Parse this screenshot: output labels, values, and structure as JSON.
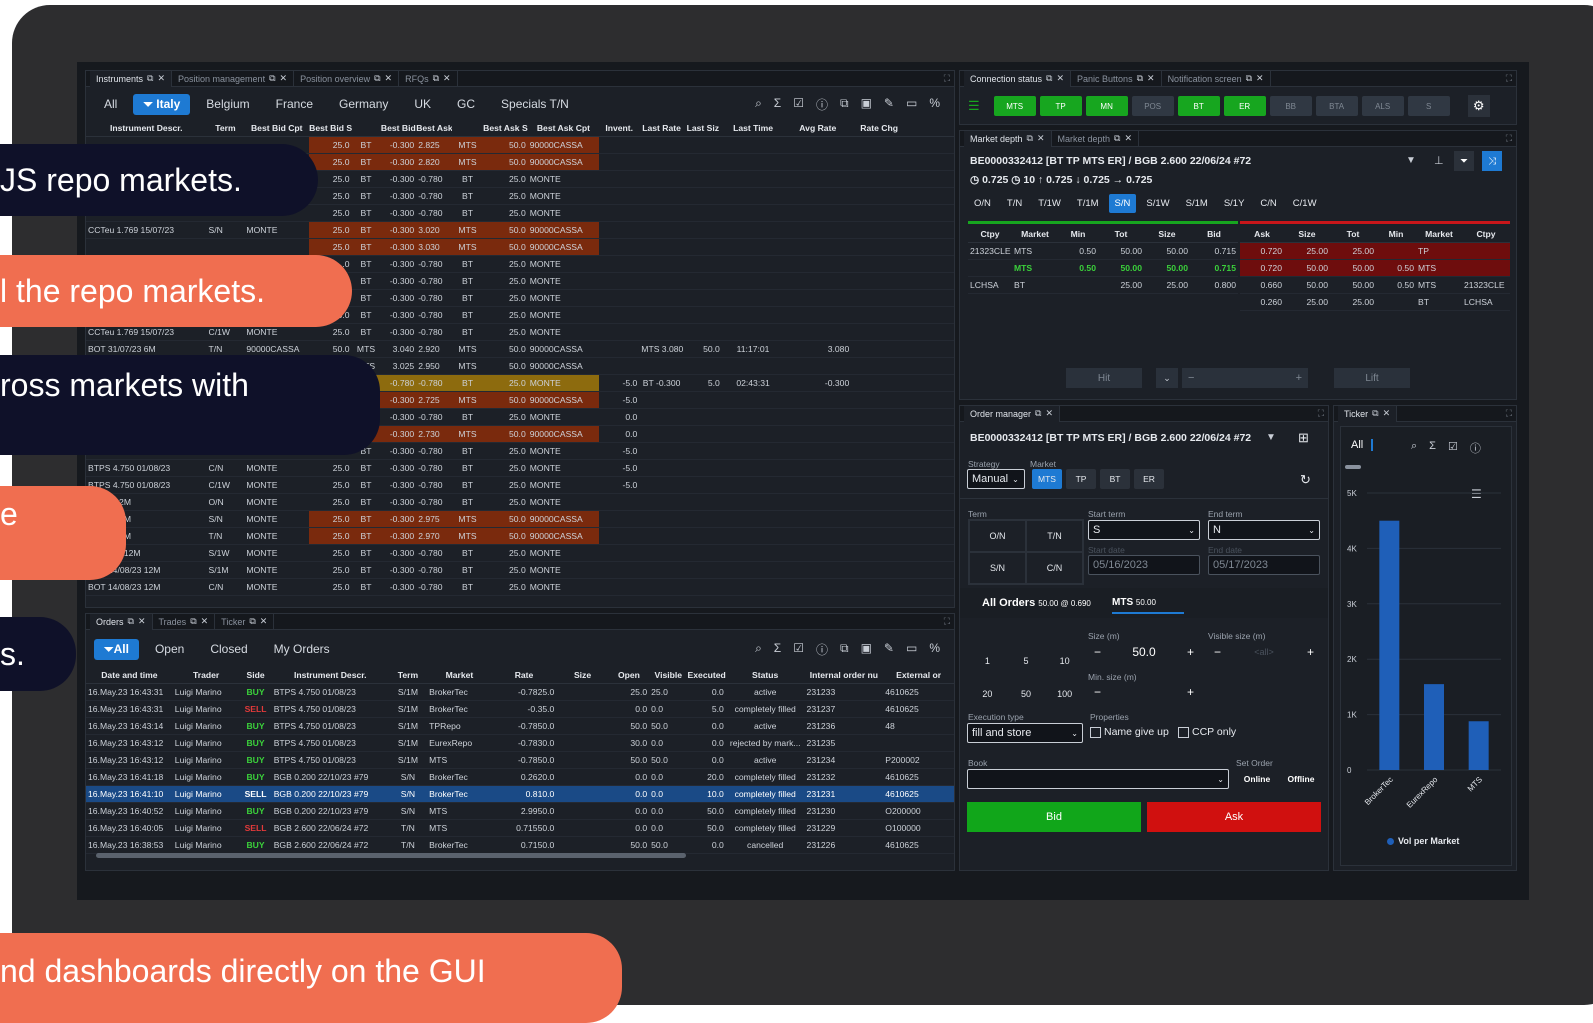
{
  "callouts": [
    {
      "text": "JS repo markets."
    },
    {
      "text": "l the repo markets."
    },
    {
      "text": "ross markets with"
    },
    {
      "text": "e"
    },
    {
      "text": "s."
    },
    {
      "text": "nd dashboards directly on the GUI"
    }
  ],
  "instruments_panel": {
    "tabs": [
      "Instruments",
      "Position management",
      "Position overview",
      "RFQs"
    ],
    "filters": [
      "All",
      "Italy",
      "Belgium",
      "France",
      "Germany",
      "UK",
      "GC",
      "Specials T/N"
    ],
    "columns": [
      "Instrument Descr.",
      "Term",
      "Best Bid Cpt",
      "Best Bid Siz",
      "Best Bid",
      "Best Ask",
      "Best Ask Siz",
      "Best Ask Cpt",
      "Invent.",
      "Last Rate",
      "Last Siz",
      "Last Time",
      "Avg Rate",
      "Rate Chg"
    ],
    "rows": [
      {
        "d": "",
        "t": "",
        "bbc": "",
        "bbs": "25.0",
        "m1": "BT",
        "bb": "-0.300",
        "ba": "2.825",
        "m2": "MTS",
        "bas": "50.0",
        "bac": "90000CASSA",
        "inv": "",
        "lr": "",
        "ls": "",
        "lt": "",
        "ar": "",
        "hl": "o"
      },
      {
        "d": "",
        "t": "",
        "bbc": "",
        "bbs": "25.0",
        "m1": "BT",
        "bb": "-0.300",
        "ba": "2.820",
        "m2": "MTS",
        "bas": "50.0",
        "bac": "90000CASSA",
        "inv": "",
        "lr": "",
        "ls": "",
        "lt": "",
        "ar": "",
        "hl": "o"
      },
      {
        "d": "",
        "t": "",
        "bbc": "",
        "bbs": "25.0",
        "m1": "BT",
        "bb": "-0.300",
        "ba": "-0.780",
        "m2": "BT",
        "bas": "25.0",
        "bac": "MONTE",
        "inv": "",
        "lr": "",
        "ls": "",
        "lt": "",
        "ar": "",
        "hl": ""
      },
      {
        "d": "",
        "t": "",
        "bbc": "",
        "bbs": "25.0",
        "m1": "BT",
        "bb": "-0.300",
        "ba": "-0.780",
        "m2": "BT",
        "bas": "25.0",
        "bac": "MONTE",
        "inv": "",
        "lr": "",
        "ls": "",
        "lt": "",
        "ar": "",
        "hl": ""
      },
      {
        "d": "BOT 14/07/23 12M",
        "t": "C/N",
        "bbc": "MONTE",
        "bbs": "25.0",
        "m1": "BT",
        "bb": "-0.300",
        "ba": "-0.780",
        "m2": "BT",
        "bas": "25.0",
        "bac": "MONTE",
        "inv": "",
        "lr": "",
        "ls": "",
        "lt": "",
        "ar": "",
        "hl": ""
      },
      {
        "d": "CCTeu 1.769 15/07/23",
        "t": "S/N",
        "bbc": "MONTE",
        "bbs": "25.0",
        "m1": "BT",
        "bb": "-0.300",
        "ba": "3.020",
        "m2": "MTS",
        "bas": "50.0",
        "bac": "90000CASSA",
        "inv": "",
        "lr": "",
        "ls": "",
        "lt": "",
        "ar": "",
        "hl": "o"
      },
      {
        "d": "",
        "t": "",
        "bbc": "",
        "bbs": "25.0",
        "m1": "BT",
        "bb": "-0.300",
        "ba": "3.030",
        "m2": "MTS",
        "bas": "50.0",
        "bac": "90000CASSA",
        "inv": "",
        "lr": "",
        "ls": "",
        "lt": "",
        "ar": "",
        "hl": "o"
      },
      {
        "d": "",
        "t": "",
        "bbc": "",
        "bbs": ".0",
        "m1": "BT",
        "bb": "-0.300",
        "ba": "-0.780",
        "m2": "BT",
        "bas": "25.0",
        "bac": "MONTE",
        "inv": "",
        "lr": "",
        "ls": "",
        "lt": "",
        "ar": "",
        "hl": ""
      },
      {
        "d": "",
        "t": "",
        "bbc": "",
        "bbs": ".0",
        "m1": "BT",
        "bb": "-0.300",
        "ba": "-0.780",
        "m2": "BT",
        "bas": "25.0",
        "bac": "MONTE",
        "inv": "",
        "lr": "",
        "ls": "",
        "lt": "",
        "ar": "",
        "hl": ""
      },
      {
        "d": "",
        "t": "",
        "bbc": "",
        "bbs": "5.0",
        "m1": "BT",
        "bb": "-0.300",
        "ba": "-0.780",
        "m2": "BT",
        "bas": "25.0",
        "bac": "MONTE",
        "inv": "",
        "lr": "",
        "ls": "",
        "lt": "",
        "ar": "",
        "hl": ""
      },
      {
        "d": "",
        "t": "",
        "bbc": "MONTE",
        "bbs": "25.0",
        "m1": "BT",
        "bb": "-0.300",
        "ba": "-0.780",
        "m2": "BT",
        "bas": "25.0",
        "bac": "MONTE",
        "inv": "",
        "lr": "",
        "ls": "",
        "lt": "",
        "ar": "",
        "hl": ""
      },
      {
        "d": "CCTeu 1.769 15/07/23",
        "t": "C/1W",
        "bbc": "MONTE",
        "bbs": "25.0",
        "m1": "BT",
        "bb": "-0.300",
        "ba": "-0.780",
        "m2": "BT",
        "bas": "25.0",
        "bac": "MONTE",
        "inv": "",
        "lr": "",
        "ls": "",
        "lt": "",
        "ar": "",
        "hl": ""
      },
      {
        "d": "BOT 31/07/23 6M",
        "t": "T/N",
        "bbc": "90000CASSA",
        "bbs": "50.0",
        "m1": "MTS",
        "bb": "3.040",
        "ba": "2.920",
        "m2": "MTS",
        "bas": "50.0",
        "bac": "90000CASSA",
        "inv": "",
        "lr": "MTS 3.080",
        "ls": "50.0",
        "lt": "11:17:01",
        "ar": "3.080",
        "hl": ""
      },
      {
        "d": "",
        "t": "",
        "bbc": "",
        "bbs": "",
        "m1": "MTS",
        "bb": "3.025",
        "ba": "2.950",
        "m2": "MTS",
        "bas": "50.0",
        "bac": "90000CASSA",
        "inv": "",
        "lr": "",
        "ls": "",
        "lt": "",
        "ar": "",
        "hl": ""
      },
      {
        "d": "",
        "t": "",
        "bbc": "",
        "bbs": "",
        "m1": "",
        "bb": "-0.780",
        "ba": "-0.780",
        "m2": "BT",
        "bas": "25.0",
        "bac": "MONTE",
        "inv": "-5.0",
        "lr": "BT -0.300",
        "ls": "5.0",
        "lt": "02:43:31",
        "ar": "-0.300",
        "hl": "y"
      },
      {
        "d": "",
        "t": "",
        "bbc": "",
        "bbs": "",
        "m1": "",
        "bb": "-0.300",
        "ba": "2.725",
        "m2": "MTS",
        "bas": "50.0",
        "bac": "90000CASSA",
        "inv": "-5.0",
        "lr": "",
        "ls": "",
        "lt": "",
        "ar": "",
        "hl": "o"
      },
      {
        "d": "",
        "t": "",
        "bbc": "",
        "bbs": "",
        "m1": "",
        "bb": "-0.300",
        "ba": "-0.780",
        "m2": "BT",
        "bas": "25.0",
        "bac": "MONTE",
        "inv": "0.0",
        "lr": "",
        "ls": "",
        "lt": "",
        "ar": "",
        "hl": ""
      },
      {
        "d": "",
        "t": "",
        "bbc": "",
        "bbs": "",
        "m1": "BT",
        "bb": "-0.300",
        "ba": "2.730",
        "m2": "MTS",
        "bas": "50.0",
        "bac": "90000CASSA",
        "inv": "0.0",
        "lr": "",
        "ls": "",
        "lt": "",
        "ar": "",
        "hl": "o"
      },
      {
        "d": "BTPS 4.750 01/08/23",
        "t": "S/1W",
        "bbc": "MONTE",
        "bbs": "25.0",
        "m1": "BT",
        "bb": "-0.300",
        "ba": "-0.780",
        "m2": "BT",
        "bas": "25.0",
        "bac": "MONTE",
        "inv": "-5.0",
        "lr": "",
        "ls": "",
        "lt": "",
        "ar": "",
        "hl": ""
      },
      {
        "d": "BTPS 4.750 01/08/23",
        "t": "C/N",
        "bbc": "MONTE",
        "bbs": "25.0",
        "m1": "BT",
        "bb": "-0.300",
        "ba": "-0.780",
        "m2": "BT",
        "bas": "25.0",
        "bac": "MONTE",
        "inv": "-5.0",
        "lr": "",
        "ls": "",
        "lt": "",
        "ar": "",
        "hl": ""
      },
      {
        "d": "BTPS 4.750 01/08/23",
        "t": "C/1W",
        "bbc": "MONTE",
        "bbs": "25.0",
        "m1": "BT",
        "bb": "-0.300",
        "ba": "-0.780",
        "m2": "BT",
        "bas": "25.0",
        "bac": "MONTE",
        "inv": "-5.0",
        "lr": "",
        "ls": "",
        "lt": "",
        "ar": "",
        "hl": ""
      },
      {
        "d": "/08/23 12M",
        "t": "O/N",
        "bbc": "MONTE",
        "bbs": "25.0",
        "m1": "BT",
        "bb": "-0.300",
        "ba": "-0.780",
        "m2": "BT",
        "bas": "25.0",
        "bac": "MONTE",
        "inv": "",
        "lr": "",
        "ls": "",
        "lt": "",
        "ar": "",
        "hl": ""
      },
      {
        "d": "/08/23 12M",
        "t": "S/N",
        "bbc": "MONTE",
        "bbs": "25.0",
        "m1": "BT",
        "bb": "-0.300",
        "ba": "2.975",
        "m2": "MTS",
        "bas": "50.0",
        "bac": "90000CASSA",
        "inv": "",
        "lr": "",
        "ls": "",
        "lt": "",
        "ar": "",
        "hl": "o"
      },
      {
        "d": "/08/23 12M",
        "t": "T/N",
        "bbc": "MONTE",
        "bbs": "25.0",
        "m1": "BT",
        "bb": "-0.300",
        "ba": "2.970",
        "m2": "MTS",
        "bas": "50.0",
        "bac": "90000CASSA",
        "inv": "",
        "lr": "",
        "ls": "",
        "lt": "",
        "ar": "",
        "hl": "o"
      },
      {
        "d": "14/08/23 12M",
        "t": "S/1W",
        "bbc": "MONTE",
        "bbs": "25.0",
        "m1": "BT",
        "bb": "-0.300",
        "ba": "-0.780",
        "m2": "BT",
        "bas": "25.0",
        "bac": "MONTE",
        "inv": "",
        "lr": "",
        "ls": "",
        "lt": "",
        "ar": "",
        "hl": ""
      },
      {
        "d": "BOT 14/08/23 12M",
        "t": "S/1M",
        "bbc": "MONTE",
        "bbs": "25.0",
        "m1": "BT",
        "bb": "-0.300",
        "ba": "-0.780",
        "m2": "BT",
        "bas": "25.0",
        "bac": "MONTE",
        "inv": "",
        "lr": "",
        "ls": "",
        "lt": "",
        "ar": "",
        "hl": ""
      },
      {
        "d": "BOT 14/08/23 12M",
        "t": "C/N",
        "bbc": "MONTE",
        "bbs": "25.0",
        "m1": "BT",
        "bb": "-0.300",
        "ba": "-0.780",
        "m2": "BT",
        "bas": "25.0",
        "bac": "MONTE",
        "inv": "",
        "lr": "",
        "ls": "",
        "lt": "",
        "ar": "",
        "hl": ""
      }
    ]
  },
  "orders_panel": {
    "tabs": [
      "Orders",
      "Trades",
      "Ticker"
    ],
    "filters": [
      "All",
      "Open",
      "Closed",
      "My Orders"
    ],
    "columns": [
      "Date and time",
      "Trader",
      "Side",
      "Instrument Descr.",
      "Term",
      "Market",
      "Rate",
      "Size",
      "Open",
      "Visible",
      "Executed",
      "Status",
      "Internal order nu",
      "External or"
    ],
    "rows": [
      {
        "dt": "16.May.23 16:43:31",
        "tr": "Luigi Marino",
        "side": "BUY",
        "ins": "BTPS 4.750 01/08/23",
        "term": "S/1M",
        "mkt": "BrokerTec",
        "rate": "-0.7825.0",
        "size": "",
        "open": "25.0",
        "vis": "25.0",
        "exe": "0.0",
        "st": "active",
        "ino": "231233",
        "ext": "4610625"
      },
      {
        "dt": "16.May.23 16:43:31",
        "tr": "Luigi Marino",
        "side": "SELL",
        "ins": "BTPS 4.750 01/08/23",
        "term": "S/1M",
        "mkt": "BrokerTec",
        "rate": "-0.35.0",
        "size": "",
        "open": "0.0",
        "vis": "0.0",
        "exe": "5.0",
        "st": "completely filled",
        "ino": "231237",
        "ext": "4610625"
      },
      {
        "dt": "16.May.23 16:43:14",
        "tr": "Luigi Marino",
        "side": "BUY",
        "ins": "BTPS 4.750 01/08/23",
        "term": "S/1M",
        "mkt": "TPRepo",
        "rate": "-0.7850.0",
        "size": "",
        "open": "50.0",
        "vis": "50.0",
        "exe": "0.0",
        "st": "active",
        "ino": "231236",
        "ext": "48"
      },
      {
        "dt": "16.May.23 16:43:12",
        "tr": "Luigi Marino",
        "side": "BUY",
        "ins": "BTPS 4.750 01/08/23",
        "term": "S/1M",
        "mkt": "EurexRepo",
        "rate": "-0.7830.0",
        "size": "",
        "open": "30.0",
        "vis": "0.0",
        "exe": "0.0",
        "st": "rejected by mark...",
        "ino": "231235",
        "ext": ""
      },
      {
        "dt": "16.May.23 16:43:12",
        "tr": "Luigi Marino",
        "side": "BUY",
        "ins": "BTPS 4.750 01/08/23",
        "term": "S/1M",
        "mkt": "MTS",
        "rate": "-0.7850.0",
        "size": "",
        "open": "50.0",
        "vis": "50.0",
        "exe": "0.0",
        "st": "active",
        "ino": "231234",
        "ext": "P200002"
      },
      {
        "dt": "16.May.23 16:41:18",
        "tr": "Luigi Marino",
        "side": "BUY",
        "ins": "BGB 0.200 22/10/23 #79",
        "term": "S/N",
        "mkt": "BrokerTec",
        "rate": "0.2620.0",
        "size": "",
        "open": "0.0",
        "vis": "0.0",
        "exe": "20.0",
        "st": "completely filled",
        "ino": "231232",
        "ext": "4610625"
      },
      {
        "dt": "16.May.23 16:41:10",
        "tr": "Luigi Marino",
        "side": "SELL",
        "ins": "BGB 0.200 22/10/23 #79",
        "term": "S/N",
        "mkt": "BrokerTec",
        "rate": "0.810.0",
        "size": "",
        "open": "0.0",
        "vis": "0.0",
        "exe": "10.0",
        "st": "completely filled",
        "ino": "231231",
        "ext": "4610625",
        "sel": true
      },
      {
        "dt": "16.May.23 16:40:52",
        "tr": "Luigi Marino",
        "side": "BUY",
        "ins": "BGB 0.200 22/10/23 #79",
        "term": "S/N",
        "mkt": "MTS",
        "rate": "2.9950.0",
        "size": "",
        "open": "0.0",
        "vis": "0.0",
        "exe": "50.0",
        "st": "completely filled",
        "ino": "231230",
        "ext": "O200000"
      },
      {
        "dt": "16.May.23 16:40:05",
        "tr": "Luigi Marino",
        "side": "SELL",
        "ins": "BGB 2.600 22/06/24 #72",
        "term": "T/N",
        "mkt": "MTS",
        "rate": "0.71550.0",
        "size": "",
        "open": "0.0",
        "vis": "0.0",
        "exe": "50.0",
        "st": "completely filled",
        "ino": "231229",
        "ext": "O100000"
      },
      {
        "dt": "16.May.23 16:38:53",
        "tr": "Luigi Marino",
        "side": "BUY",
        "ins": "BGB 2.600 22/06/24 #72",
        "term": "T/N",
        "mkt": "BrokerTec",
        "rate": "0.7150.0",
        "size": "",
        "open": "50.0",
        "vis": "50.0",
        "exe": "0.0",
        "st": "cancelled",
        "ino": "231226",
        "ext": "4610625"
      }
    ]
  },
  "connection_panel": {
    "tabs": [
      "Connection status",
      "Panic Buttons",
      "Notification screen"
    ],
    "buttons": [
      {
        "label": "MTS",
        "on": true
      },
      {
        "label": "TP",
        "on": true
      },
      {
        "label": "MN",
        "on": true
      },
      {
        "label": "POS",
        "on": false
      },
      {
        "label": "BT",
        "on": true
      },
      {
        "label": "ER",
        "on": true
      },
      {
        "label": "BB",
        "on": false
      },
      {
        "label": "BTA",
        "on": false
      },
      {
        "label": "ALS",
        "on": false
      },
      {
        "label": "S",
        "on": false
      }
    ]
  },
  "depth_panel": {
    "tabs": [
      "Market depth",
      "Market depth"
    ],
    "instrument": "BE0000332412 [BT TP MTS ER] / BGB 2.600 22/06/24 #72",
    "stats": "0.725 ◷ 10 ↑ 0.725 ↓ 0.725 → 0.725",
    "terms": [
      "O/N",
      "T/N",
      "T/1W",
      "T/1M",
      "S/N",
      "S/1W",
      "S/1M",
      "S/1Y",
      "C/N",
      "C/1W"
    ],
    "active_term": "S/N",
    "bid_cols": [
      "Ctpy",
      "Market",
      "Min",
      "Tot",
      "Size",
      "Bid"
    ],
    "ask_cols": [
      "Ask",
      "Size",
      "Tot",
      "Min",
      "Market",
      "Ctpy"
    ],
    "bid_rows": [
      {
        "ctpy": "21323CLE",
        "mkt": "MTS",
        "min": "0.50",
        "tot": "50.00",
        "size": "50.00",
        "px": "0.715"
      },
      {
        "ctpy": "",
        "mkt": "MTS",
        "min": "0.50",
        "tot": "50.00",
        "size": "50.00",
        "px": "0.715"
      },
      {
        "ctpy": "LCHSA",
        "mkt": "BT",
        "min": "",
        "tot": "25.00",
        "size": "25.00",
        "px": "0.800"
      }
    ],
    "ask_rows": [
      {
        "px": "0.720",
        "size": "25.00",
        "tot": "25.00",
        "min": "",
        "mkt": "TP",
        "ctpy": ""
      },
      {
        "px": "0.720",
        "size": "50.00",
        "tot": "50.00",
        "min": "0.50",
        "mkt": "MTS",
        "ctpy": ""
      },
      {
        "px": "0.660",
        "size": "50.00",
        "tot": "50.00",
        "min": "0.50",
        "mkt": "MTS",
        "ctpy": "21323CLE"
      },
      {
        "px": "0.260",
        "size": "25.00",
        "tot": "25.00",
        "min": "",
        "mkt": "BT",
        "ctpy": "LCHSA"
      }
    ],
    "hit": "Hit",
    "lift": "Lift"
  },
  "order_manager": {
    "tab": "Order manager",
    "instrument": "BE0000332412 [BT TP MTS ER] / BGB 2.600 22/06/24 #72",
    "strategy_label": "Strategy",
    "strategy": "Manual",
    "market_label": "Market",
    "markets": [
      "MTS",
      "TP",
      "BT",
      "ER"
    ],
    "term_label": "Term",
    "terms": [
      "O/N",
      "T/N",
      "S/N",
      "C/N"
    ],
    "start_term_label": "Start term",
    "start_term": "S",
    "end_term_label": "End term",
    "end_term": "N",
    "start_date_label": "Start date",
    "start_date": "05/16/2023",
    "end_date_label": "End date",
    "end_date": "05/17/2023",
    "all_orders": "All Orders",
    "all_orders_sub": "50.00 @ 0.690",
    "mts_tab": "MTS",
    "mts_sub": "50.00",
    "size_label": "Size (m)",
    "size": "50.0",
    "vis_label": "Visible size (m)",
    "vis_placeholder": "<all>",
    "min_label": "Min. size (m)",
    "quick": [
      "1",
      "5",
      "10",
      "20",
      "50",
      "100"
    ],
    "exec_label": "Execution type",
    "exec": "fill and store",
    "props_label": "Properties",
    "prop1": "Name give up",
    "prop2": "CCP only",
    "book_label": "Book",
    "set_order_label": "Set Order",
    "online": "Online",
    "offline": "Offline",
    "bid": "Bid",
    "ask": "Ask"
  },
  "ticker_panel": {
    "tab": "Ticker",
    "filter": "All"
  },
  "chart_data": {
    "type": "bar",
    "categories": [
      "BrokerTec",
      "EurexRepo",
      "MTS"
    ],
    "values": [
      4500,
      1550,
      880
    ],
    "ylim": [
      0,
      5000
    ],
    "yticks": [
      "0",
      "1K",
      "2K",
      "3K",
      "4K",
      "5K"
    ],
    "legend": "Vol per Market",
    "color": "#1f5fb8"
  }
}
